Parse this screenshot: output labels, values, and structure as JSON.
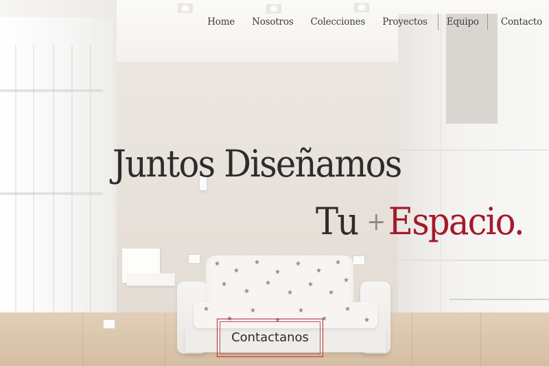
{
  "nav": {
    "items": [
      {
        "label": "Home"
      },
      {
        "label": "Nosotros"
      },
      {
        "label": "Colecciones"
      },
      {
        "label": "Proyectos"
      },
      {
        "label": "Equipo",
        "active": true
      },
      {
        "label": "Contacto"
      }
    ]
  },
  "hero": {
    "line1": "Juntos Diseñamos",
    "line2_word": "Tu",
    "line2_plus": "+",
    "line2_accent": "Espacio."
  },
  "cta": {
    "label": "Contactanos"
  },
  "colors": {
    "accent": "#a41a2a",
    "text": "#2d2b2b",
    "button_border": "#b52a36"
  }
}
